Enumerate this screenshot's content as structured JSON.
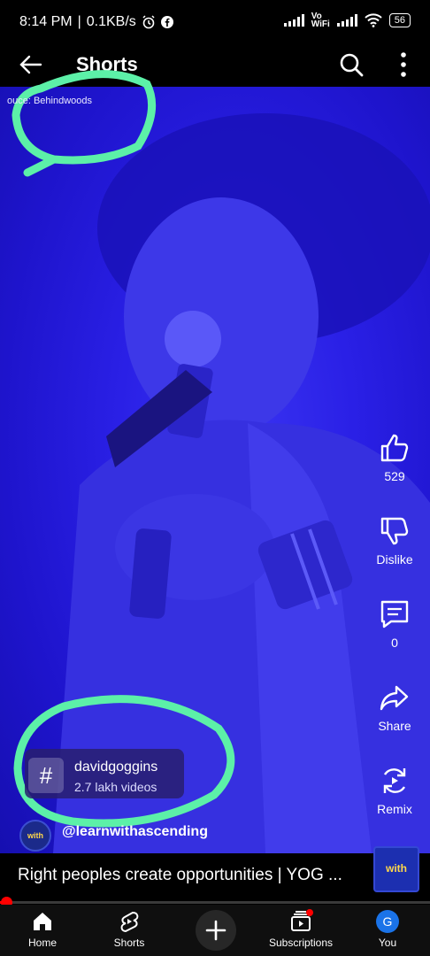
{
  "status_bar": {
    "time": "8:14 PM",
    "speed": "0.1KB/s",
    "vo_wifi": "Vo\nWiFi",
    "battery": "56"
  },
  "header": {
    "title": "Shorts"
  },
  "video": {
    "source_text": "ouce: Behindwoods",
    "annotation_color": "#5cf0a8",
    "tint_color": "#2a20e6"
  },
  "actions": {
    "like_count": "529",
    "dislike_label": "Dislike",
    "comment_count": "0",
    "share_label": "Share",
    "remix_label": "Remix"
  },
  "hashtag": {
    "symbol": "#",
    "name": "davidgoggins",
    "count": "2.7 lakh videos"
  },
  "channel": {
    "handle": "@learnwithascending",
    "avatar_text": "with"
  },
  "video_title": {
    "text": "Right peoples create opportunities | YOG ...",
    "thumb_text": "with"
  },
  "playback": {
    "progress": 0.01
  },
  "nav": {
    "home": "Home",
    "shorts": "Shorts",
    "subscriptions": "Subscriptions",
    "you": "You",
    "you_initial": "G"
  }
}
